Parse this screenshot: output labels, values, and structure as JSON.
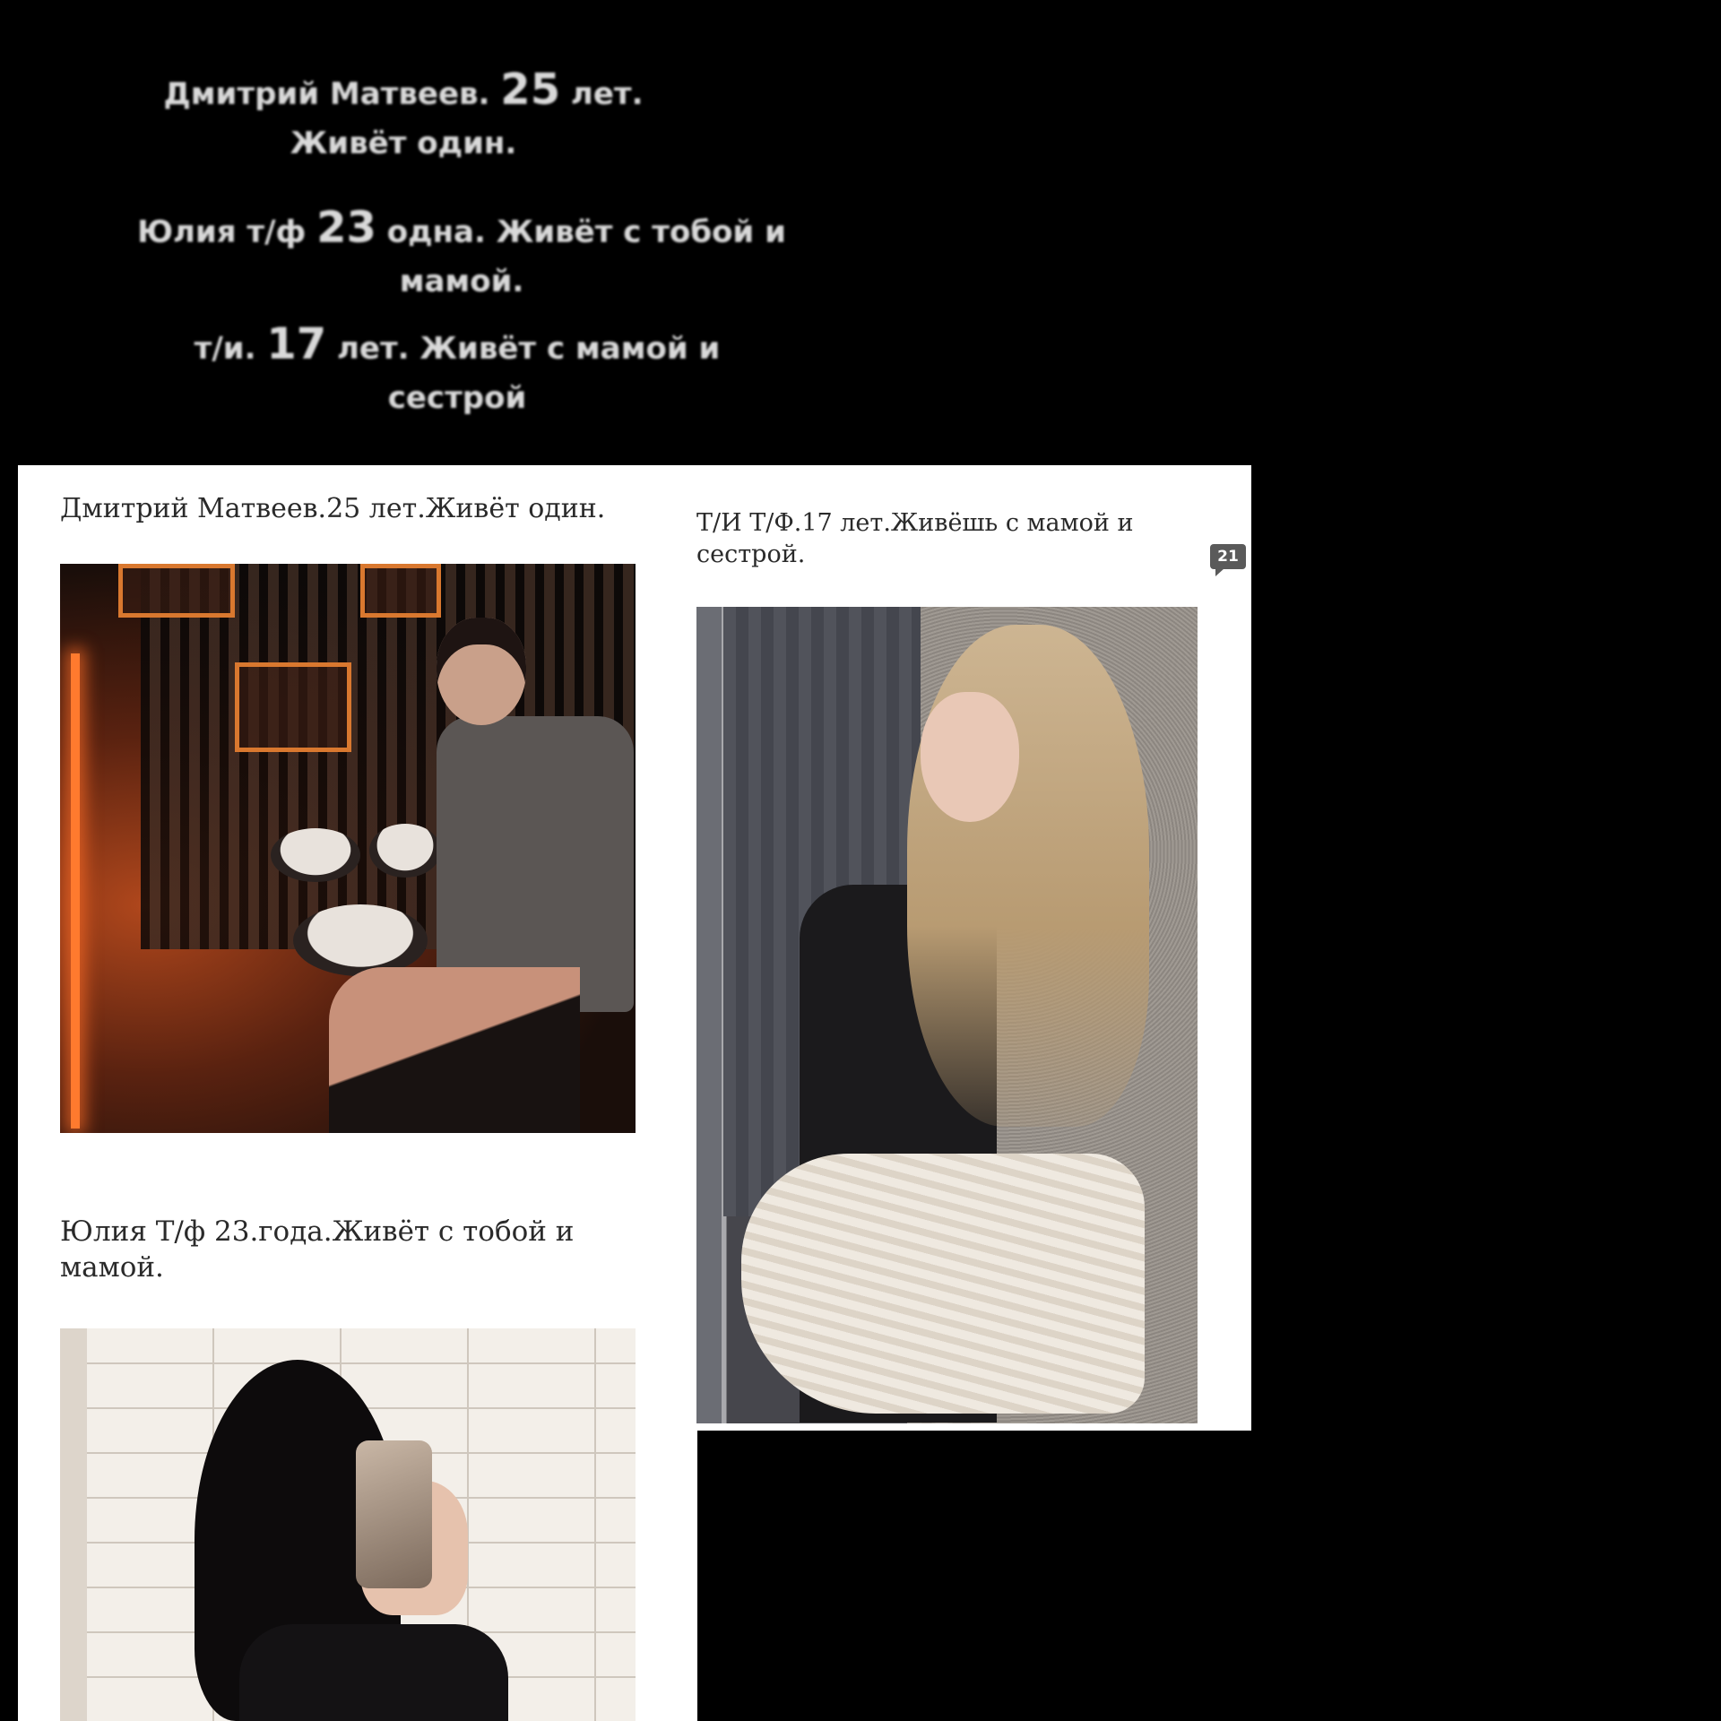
{
  "top_captions": [
    {
      "before": "Дмитрий Матвеев. ",
      "num": "25",
      "after": " лет. Живёт один."
    },
    {
      "before": "Юлия т/ф ",
      "num": "23",
      "after": " одна. Живёт с тобой и мамой."
    },
    {
      "before": "т/и. ",
      "num": "17",
      "after": " лет. Живёт с мамой и сестрой"
    }
  ],
  "board": {
    "dmitriy_label": "Дмитрий Матвеев.25 лет.Живёт один.",
    "ti_label": "Т/И Т/Ф.17 лет.Живёшь с мамой и сестрой.",
    "yulia_label": "Юлия Т/ф 23.года.Живёт с тобой и мамой.",
    "comment_badge": "21"
  }
}
